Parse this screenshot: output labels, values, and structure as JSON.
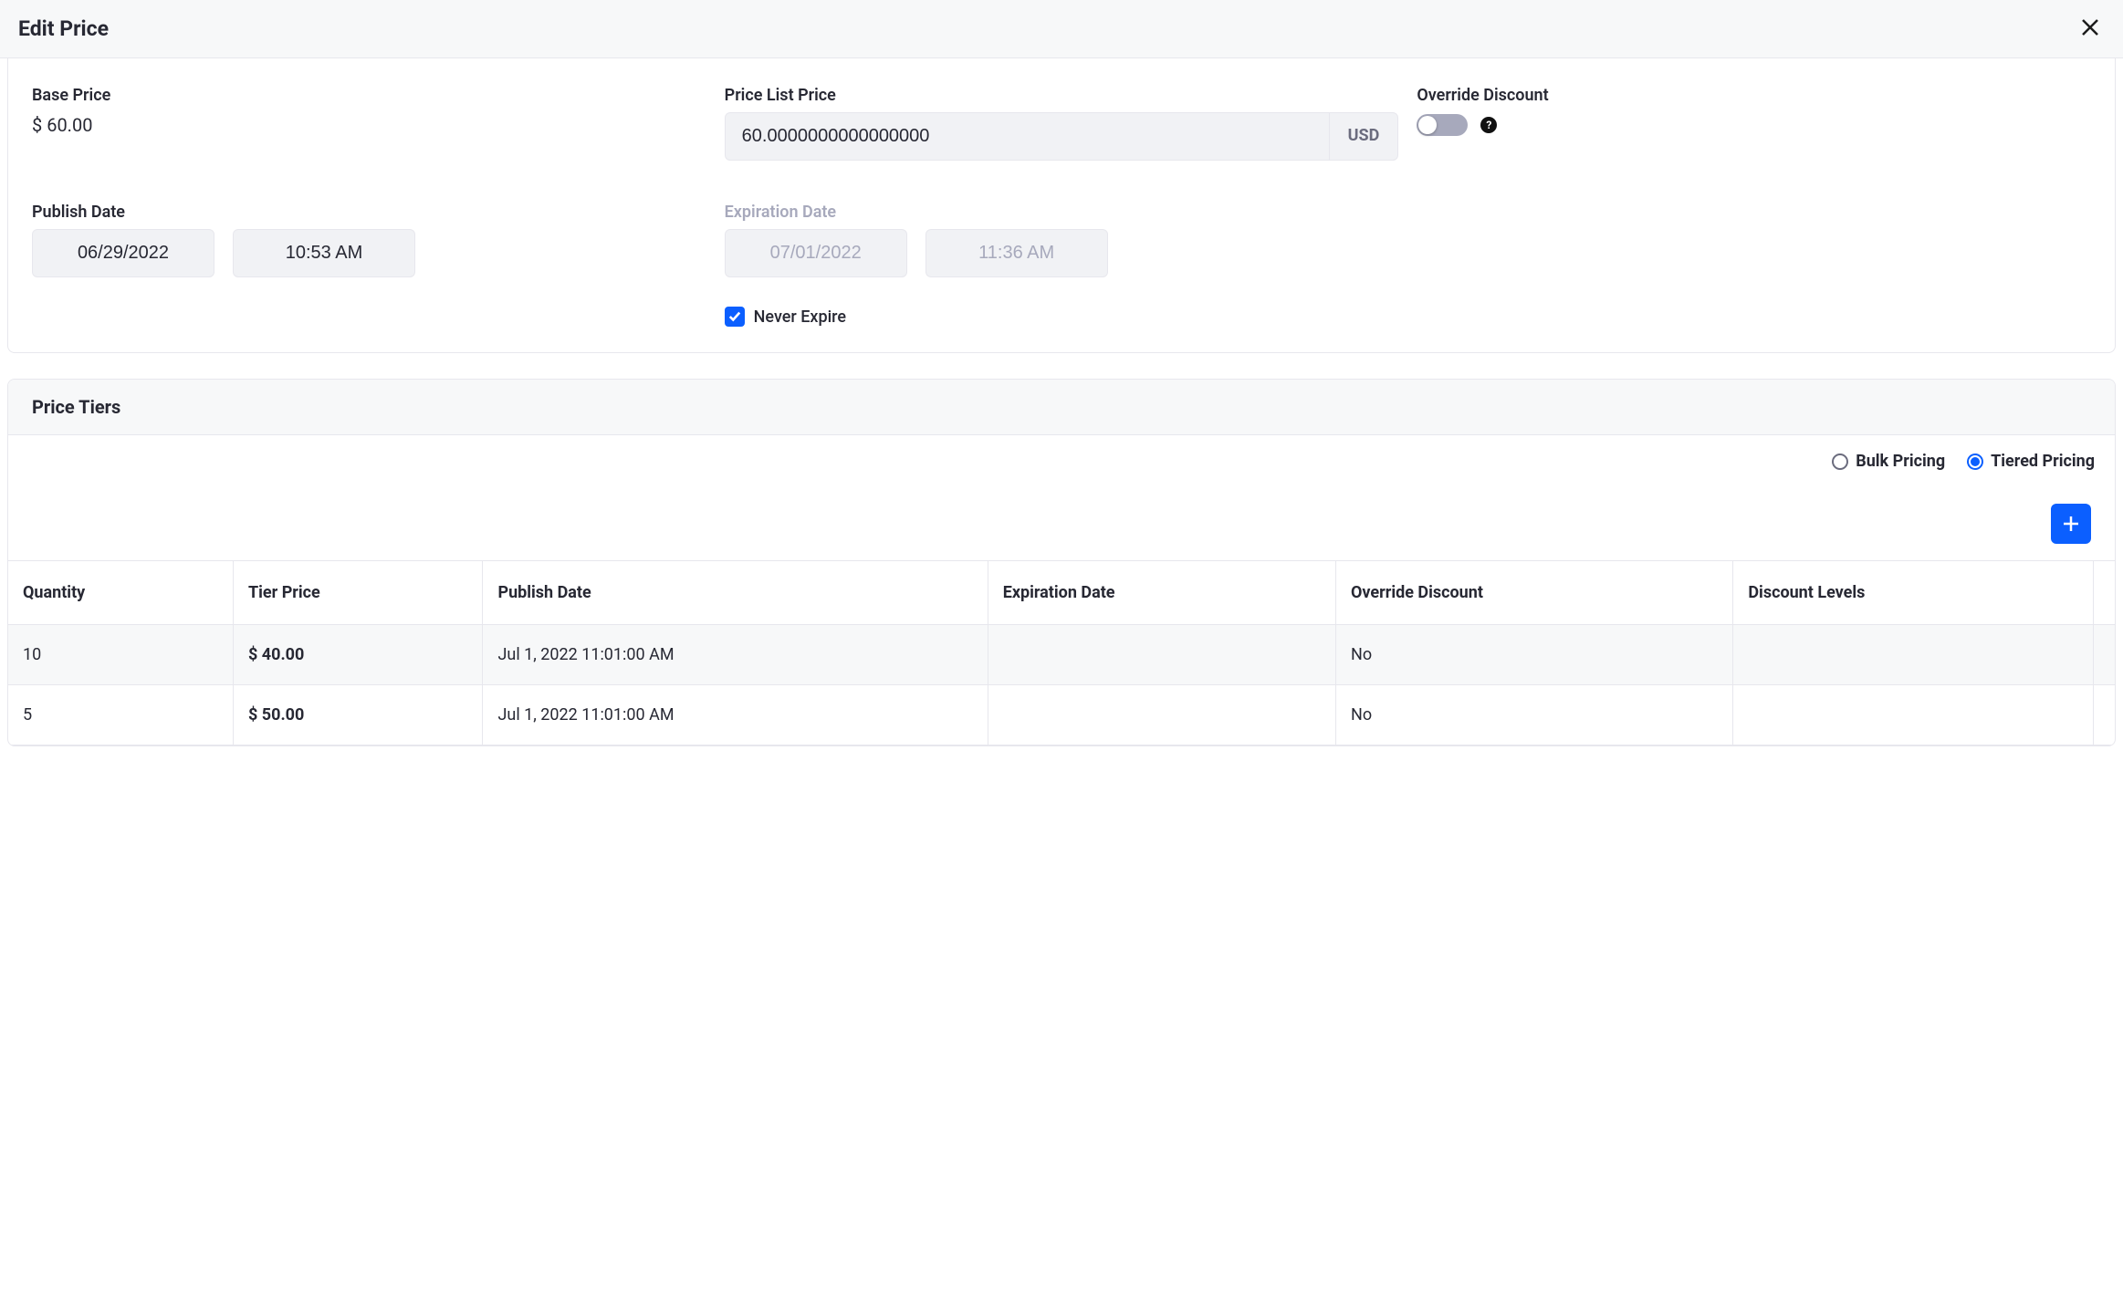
{
  "modal": {
    "title": "Edit Price"
  },
  "base_price": {
    "label": "Base Price",
    "value": "$ 60.00"
  },
  "price_list_price": {
    "label": "Price List Price",
    "value": "60.0000000000000000",
    "currency": "USD"
  },
  "override_discount": {
    "label": "Override Discount",
    "help": "?"
  },
  "publish_date": {
    "label": "Publish Date",
    "date": "06/29/2022",
    "time": "10:53 AM"
  },
  "expiration_date": {
    "label": "Expiration Date",
    "date": "07/01/2022",
    "time": "11:36 AM"
  },
  "never_expire": {
    "label": "Never Expire",
    "checked": true
  },
  "tiers": {
    "heading": "Price Tiers",
    "pricing_types": {
      "bulk": "Bulk Pricing",
      "tiered": "Tiered Pricing"
    },
    "columns": {
      "quantity": "Quantity",
      "tier_price": "Tier Price",
      "publish_date": "Publish Date",
      "expiration_date": "Expiration Date",
      "override_discount": "Override Discount",
      "discount_levels": "Discount Levels"
    },
    "rows": [
      {
        "quantity": "10",
        "tier_price": "$ 40.00",
        "publish_date": "Jul 1, 2022 11:01:00 AM",
        "expiration_date": "",
        "override_discount": "No",
        "discount_levels": ""
      },
      {
        "quantity": "5",
        "tier_price": "$ 50.00",
        "publish_date": "Jul 1, 2022 11:01:00 AM",
        "expiration_date": "",
        "override_discount": "No",
        "discount_levels": ""
      }
    ]
  }
}
